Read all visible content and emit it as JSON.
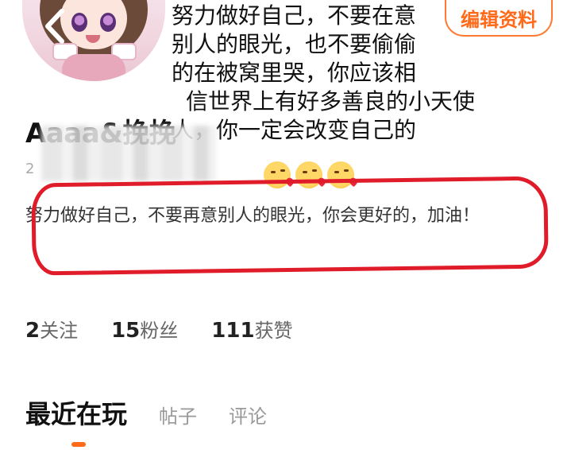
{
  "profile": {
    "username": "Aaaa&挽挽",
    "id_prefix": "2",
    "edit_button_label": "编辑资料",
    "signature": "努力做好自己，不要再意别人的眼光，你会更好的，加油！"
  },
  "overlay_text": {
    "line1": "努力做好自己，不要在意",
    "line2": "别人的眼光，也不要偷偷",
    "line3": "的在被窝里哭，你应该相",
    "line4": "信世界上有好多善良的小天使",
    "line5": "人，你一定会改变自己的"
  },
  "emojis": [
    "kissing-heart-emoji",
    "kissing-heart-emoji",
    "kissing-heart-emoji"
  ],
  "stats": {
    "following_count": "2",
    "following_label": "关注",
    "fans_count": "15",
    "fans_label": "粉丝",
    "likes_count": "111",
    "likes_label": "获赞"
  },
  "tabs": [
    {
      "label": "最近在玩",
      "active": true
    },
    {
      "label": "帖子",
      "active": false
    },
    {
      "label": "评论",
      "active": false
    }
  ],
  "colors": {
    "accent": "#ff6a1a",
    "annotation_red": "#e01b2a"
  }
}
